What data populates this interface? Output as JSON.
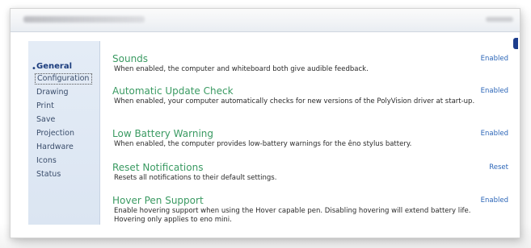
{
  "window": {
    "title": "",
    "title_right": ""
  },
  "sidebar": {
    "items": [
      {
        "label": "General",
        "state": "active"
      },
      {
        "label": "Configuration",
        "state": "selected"
      },
      {
        "label": "Drawing",
        "state": ""
      },
      {
        "label": "Print",
        "state": ""
      },
      {
        "label": "Save",
        "state": ""
      },
      {
        "label": "Projection",
        "state": ""
      },
      {
        "label": "Hardware",
        "state": ""
      },
      {
        "label": "Icons",
        "state": ""
      },
      {
        "label": "Status",
        "state": ""
      }
    ]
  },
  "settings": [
    {
      "title": "Sounds",
      "description": "When enabled, the computer and whiteboard both give audible feedback.",
      "status": "Enabled"
    },
    {
      "title": "Automatic Update Check",
      "description": "When enabled, your computer automatically checks for new versions of the PolyVision driver at start-up.",
      "status": "Enabled"
    },
    {
      "title": "Low Battery Warning",
      "description": "When enabled, the computer provides low-battery warnings for the êno stylus battery.",
      "status": "Enabled"
    },
    {
      "title": "Reset Notifications",
      "description": "Resets all notifications to their default settings.",
      "status": "Reset"
    },
    {
      "title": "Hover Pen Support",
      "description": "Enable hovering support when using the Hover capable pen. Disabling hovering will extend battery life. Hovering only applies to eno mini.",
      "status": "Enabled"
    }
  ],
  "colors": {
    "setting_title": "#3a9a62",
    "status_link": "#2c66b8",
    "nav_active": "#1b3c7d",
    "sidebar_bg": "#dbe5f2"
  },
  "icons": {
    "nav_bullet": "bullet-icon",
    "edge": "scroll-edge-icon"
  }
}
